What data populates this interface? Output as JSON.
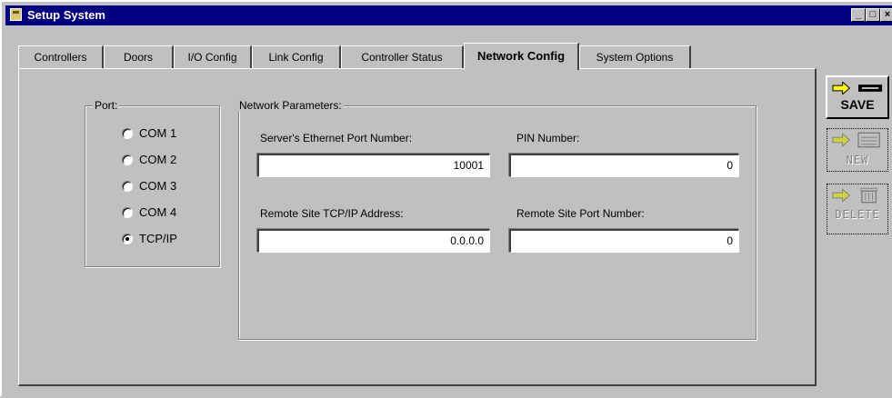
{
  "window": {
    "title": "Setup System"
  },
  "titlebar_buttons": {
    "minimize": "_",
    "maximize": "□",
    "close": "×"
  },
  "tabs": [
    {
      "label": "Controllers"
    },
    {
      "label": "Doors"
    },
    {
      "label": "I/O Config"
    },
    {
      "label": "Link Config"
    },
    {
      "label": "Controller Status"
    },
    {
      "label": "Network Config"
    },
    {
      "label": "System Options"
    }
  ],
  "active_tab": "Network Config",
  "port_group": {
    "label": "Port:",
    "options": [
      {
        "label": "COM 1",
        "checked": false
      },
      {
        "label": "COM 2",
        "checked": false
      },
      {
        "label": "COM 3",
        "checked": false
      },
      {
        "label": "COM 4",
        "checked": false
      },
      {
        "label": "TCP/IP",
        "checked": true
      }
    ]
  },
  "network_group": {
    "label": "Network Parameters:",
    "server_port_label": "Server's Ethernet Port Number:",
    "server_port_value": "10001",
    "pin_label": "PIN Number:",
    "pin_value": "0",
    "remote_address_label": "Remote Site TCP/IP Address:",
    "remote_address_value": "0.0.0.0",
    "remote_port_label": "Remote Site Port Number:",
    "remote_port_value": "0"
  },
  "side_buttons": {
    "save": {
      "label": "SAVE",
      "enabled": true
    },
    "new": {
      "label": "NEW",
      "enabled": false
    },
    "delete": {
      "label": "DELETE",
      "enabled": false
    }
  },
  "colors": {
    "titlebar": "#000080",
    "face": "#c0c0c0",
    "save_arrow": "#ffff00"
  },
  "icons": {
    "save": "arrow-to-disk-icon",
    "new": "arrow-to-card-icon",
    "delete": "arrow-to-trash-icon"
  }
}
